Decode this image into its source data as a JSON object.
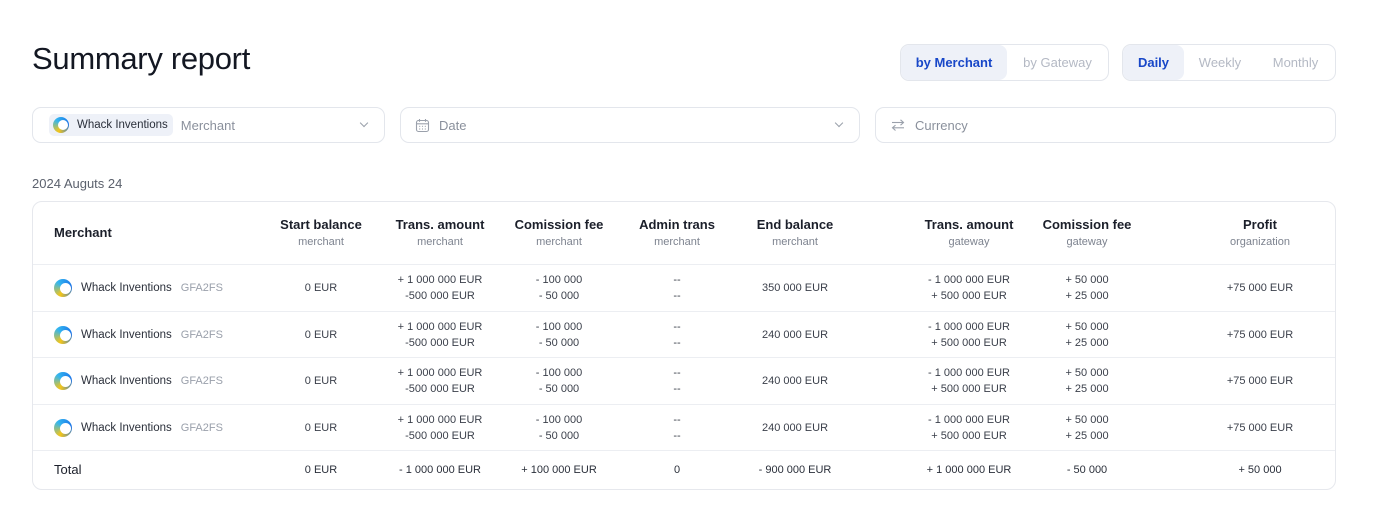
{
  "page": {
    "title": "Summary report",
    "date_label": "2024 Auguts 24"
  },
  "view_toggle": {
    "options": [
      "by Merchant",
      "by Gateway"
    ],
    "active": "by Merchant"
  },
  "period_toggle": {
    "options": [
      "Daily",
      "Weekly",
      "Monthly"
    ],
    "active": "Daily"
  },
  "filters": {
    "merchant": {
      "chip": "Whack Inventions",
      "placeholder": "Merchant",
      "icon": "chevron-down-icon"
    },
    "date": {
      "placeholder": "Date",
      "icon": "calendar-icon"
    },
    "currency": {
      "placeholder": "Currency",
      "icon": "swap-icon"
    }
  },
  "table": {
    "columns": [
      {
        "title": "Merchant",
        "sub": ""
      },
      {
        "title": "Start balance",
        "sub": "merchant"
      },
      {
        "title": "Trans. amount",
        "sub": "merchant"
      },
      {
        "title": "Comission fee",
        "sub": "merchant"
      },
      {
        "title": "Admin trans",
        "sub": "merchant"
      },
      {
        "title": "End balance",
        "sub": "merchant"
      },
      {
        "title": "Trans. amount",
        "sub": "gateway"
      },
      {
        "title": "Comission fee",
        "sub": "gateway"
      },
      {
        "title": "Profit",
        "sub": "organization"
      }
    ],
    "rows": [
      {
        "merchant": "Whack Inventions",
        "code": "GFA2FS",
        "start": "0 EUR",
        "trans": [
          "+ 1 000 000 EUR",
          "-500 000 EUR"
        ],
        "comm": [
          "- 100 000",
          "- 50 000"
        ],
        "admin": [
          "--",
          "--"
        ],
        "end": "350 000 EUR",
        "gtrans": [
          "- 1 000 000 EUR",
          "+ 500 000 EUR"
        ],
        "gcomm": [
          "+ 50 000",
          "+ 25 000"
        ],
        "profit": "+75 000 EUR"
      },
      {
        "merchant": "Whack Inventions",
        "code": "GFA2FS",
        "start": "0 EUR",
        "trans": [
          "+ 1 000 000 EUR",
          "-500 000 EUR"
        ],
        "comm": [
          "- 100 000",
          "- 50 000"
        ],
        "admin": [
          "--",
          "--"
        ],
        "end": "240 000 EUR",
        "gtrans": [
          "- 1 000 000 EUR",
          "+ 500 000 EUR"
        ],
        "gcomm": [
          "+ 50 000",
          "+ 25 000"
        ],
        "profit": "+75 000 EUR"
      },
      {
        "merchant": "Whack Inventions",
        "code": "GFA2FS",
        "start": "0 EUR",
        "trans": [
          "+ 1 000 000 EUR",
          "-500 000 EUR"
        ],
        "comm": [
          "- 100 000",
          "- 50 000"
        ],
        "admin": [
          "--",
          "--"
        ],
        "end": "240 000 EUR",
        "gtrans": [
          "- 1 000 000 EUR",
          "+ 500 000 EUR"
        ],
        "gcomm": [
          "+ 50 000",
          "+ 25 000"
        ],
        "profit": "+75 000 EUR"
      },
      {
        "merchant": "Whack Inventions",
        "code": "GFA2FS",
        "start": "0 EUR",
        "trans": [
          "+ 1 000 000 EUR",
          "-500 000 EUR"
        ],
        "comm": [
          "- 100 000",
          "- 50 000"
        ],
        "admin": [
          "--",
          "--"
        ],
        "end": "240 000 EUR",
        "gtrans": [
          "- 1 000 000 EUR",
          "+ 500 000 EUR"
        ],
        "gcomm": [
          "+ 50 000",
          "+ 25 000"
        ],
        "profit": "+75 000 EUR"
      }
    ],
    "total": {
      "label": "Total",
      "start": "0 EUR",
      "trans": "- 1 000 000 EUR",
      "comm": "+ 100 000 EUR",
      "admin": "0",
      "end": "- 900 000 EUR",
      "gtrans": "+ 1 000 000 EUR",
      "gcomm": "- 50 000",
      "profit": "+ 50 000"
    }
  },
  "colors": {
    "accent": "#1847c8",
    "active_bg": "#eef1f8",
    "border": "#e3e6ec"
  }
}
